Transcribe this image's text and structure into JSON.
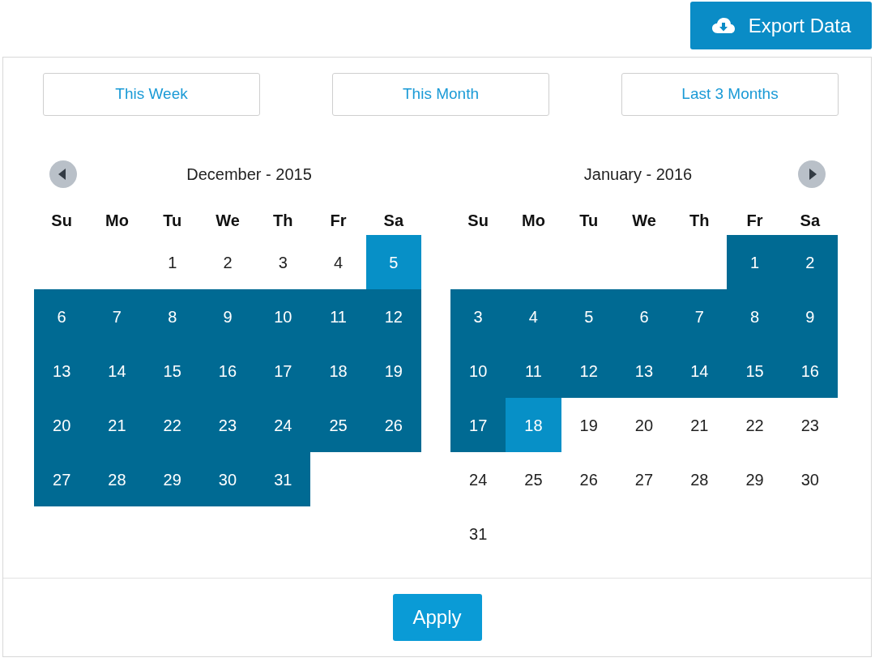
{
  "export_button": {
    "label": "Export Data"
  },
  "presets": [
    {
      "label": "This Week"
    },
    {
      "label": "This Month"
    },
    {
      "label": "Last 3 Months"
    }
  ],
  "months": [
    {
      "title": "December - 2015",
      "prev_arrow": true,
      "next_arrow": false,
      "weekdays": [
        "Su",
        "Mo",
        "Tu",
        "We",
        "Th",
        "Fr",
        "Sa"
      ],
      "weeks": [
        [
          {
            "kind": "blank"
          },
          {
            "kind": "blank"
          },
          {
            "kind": "day",
            "label": "1",
            "in_range": false,
            "selected": false
          },
          {
            "kind": "day",
            "label": "2",
            "in_range": false,
            "selected": false
          },
          {
            "kind": "day",
            "label": "3",
            "in_range": false,
            "selected": false
          },
          {
            "kind": "day",
            "label": "4",
            "in_range": false,
            "selected": false
          },
          {
            "kind": "day",
            "label": "5",
            "selected": true
          }
        ],
        [
          {
            "kind": "day",
            "label": "6",
            "in_range": true,
            "selected": false
          },
          {
            "kind": "day",
            "label": "7",
            "in_range": true,
            "selected": false
          },
          {
            "kind": "day",
            "label": "8",
            "in_range": true,
            "selected": false
          },
          {
            "kind": "day",
            "label": "9",
            "in_range": true,
            "selected": false
          },
          {
            "kind": "day",
            "label": "10",
            "in_range": true,
            "selected": false
          },
          {
            "kind": "day",
            "label": "11",
            "in_range": true,
            "selected": false
          },
          {
            "kind": "day",
            "label": "12",
            "in_range": true,
            "selected": false
          }
        ],
        [
          {
            "kind": "day",
            "label": "13",
            "in_range": true,
            "selected": false
          },
          {
            "kind": "day",
            "label": "14",
            "in_range": true,
            "selected": false
          },
          {
            "kind": "day",
            "label": "15",
            "in_range": true,
            "selected": false
          },
          {
            "kind": "day",
            "label": "16",
            "in_range": true,
            "selected": false
          },
          {
            "kind": "day",
            "label": "17",
            "in_range": true,
            "selected": false
          },
          {
            "kind": "day",
            "label": "18",
            "in_range": true,
            "selected": false
          },
          {
            "kind": "day",
            "label": "19",
            "in_range": true,
            "selected": false
          }
        ],
        [
          {
            "kind": "day",
            "label": "20",
            "in_range": true,
            "selected": false
          },
          {
            "kind": "day",
            "label": "21",
            "in_range": true,
            "selected": false
          },
          {
            "kind": "day",
            "label": "22",
            "in_range": true,
            "selected": false
          },
          {
            "kind": "day",
            "label": "23",
            "in_range": true,
            "selected": false
          },
          {
            "kind": "day",
            "label": "24",
            "in_range": true,
            "selected": false
          },
          {
            "kind": "day",
            "label": "25",
            "in_range": true,
            "selected": false
          },
          {
            "kind": "day",
            "label": "26",
            "in_range": true,
            "selected": false
          }
        ],
        [
          {
            "kind": "day",
            "label": "27",
            "in_range": true,
            "selected": false
          },
          {
            "kind": "day",
            "label": "28",
            "in_range": true,
            "selected": false
          },
          {
            "kind": "day",
            "label": "29",
            "in_range": true,
            "selected": false
          },
          {
            "kind": "day",
            "label": "30",
            "in_range": true,
            "selected": false
          },
          {
            "kind": "day",
            "label": "31",
            "in_range": true,
            "selected": false
          },
          {
            "kind": "blank"
          },
          {
            "kind": "blank"
          }
        ]
      ]
    },
    {
      "title": "January - 2016",
      "prev_arrow": false,
      "next_arrow": true,
      "weekdays": [
        "Su",
        "Mo",
        "Tu",
        "We",
        "Th",
        "Fr",
        "Sa"
      ],
      "weeks": [
        [
          {
            "kind": "blank"
          },
          {
            "kind": "blank"
          },
          {
            "kind": "blank"
          },
          {
            "kind": "blank"
          },
          {
            "kind": "blank"
          },
          {
            "kind": "day",
            "label": "1",
            "in_range": true,
            "selected": false
          },
          {
            "kind": "day",
            "label": "2",
            "in_range": true,
            "selected": false
          }
        ],
        [
          {
            "kind": "day",
            "label": "3",
            "in_range": true,
            "selected": false
          },
          {
            "kind": "day",
            "label": "4",
            "in_range": true,
            "selected": false
          },
          {
            "kind": "day",
            "label": "5",
            "in_range": true,
            "selected": false
          },
          {
            "kind": "day",
            "label": "6",
            "in_range": true,
            "selected": false
          },
          {
            "kind": "day",
            "label": "7",
            "in_range": true,
            "selected": false
          },
          {
            "kind": "day",
            "label": "8",
            "in_range": true,
            "selected": false
          },
          {
            "kind": "day",
            "label": "9",
            "in_range": true,
            "selected": false
          }
        ],
        [
          {
            "kind": "day",
            "label": "10",
            "in_range": true,
            "selected": false
          },
          {
            "kind": "day",
            "label": "11",
            "in_range": true,
            "selected": false
          },
          {
            "kind": "day",
            "label": "12",
            "in_range": true,
            "selected": false
          },
          {
            "kind": "day",
            "label": "13",
            "in_range": true,
            "selected": false
          },
          {
            "kind": "day",
            "label": "14",
            "in_range": true,
            "selected": false
          },
          {
            "kind": "day",
            "label": "15",
            "in_range": true,
            "selected": false
          },
          {
            "kind": "day",
            "label": "16",
            "in_range": true,
            "selected": false
          }
        ],
        [
          {
            "kind": "day",
            "label": "17",
            "in_range": true,
            "selected": false
          },
          {
            "kind": "day",
            "label": "18",
            "selected": true
          },
          {
            "kind": "day",
            "label": "19",
            "in_range": false,
            "selected": false
          },
          {
            "kind": "day",
            "label": "20",
            "in_range": false,
            "selected": false
          },
          {
            "kind": "day",
            "label": "21",
            "in_range": false,
            "selected": false
          },
          {
            "kind": "day",
            "label": "22",
            "in_range": false,
            "selected": false
          },
          {
            "kind": "day",
            "label": "23",
            "in_range": false,
            "selected": false
          }
        ],
        [
          {
            "kind": "day",
            "label": "24",
            "in_range": false,
            "selected": false
          },
          {
            "kind": "day",
            "label": "25",
            "in_range": false,
            "selected": false
          },
          {
            "kind": "day",
            "label": "26",
            "in_range": false,
            "selected": false
          },
          {
            "kind": "day",
            "label": "27",
            "in_range": false,
            "selected": false
          },
          {
            "kind": "day",
            "label": "28",
            "in_range": false,
            "selected": false
          },
          {
            "kind": "day",
            "label": "29",
            "in_range": false,
            "selected": false
          },
          {
            "kind": "day",
            "label": "30",
            "in_range": false,
            "selected": false
          }
        ],
        [
          {
            "kind": "day",
            "label": "31",
            "in_range": false,
            "selected": false
          },
          {
            "kind": "blank"
          },
          {
            "kind": "blank"
          },
          {
            "kind": "blank"
          },
          {
            "kind": "blank"
          },
          {
            "kind": "blank"
          },
          {
            "kind": "blank"
          }
        ]
      ]
    }
  ],
  "apply_button": {
    "label": "Apply"
  }
}
